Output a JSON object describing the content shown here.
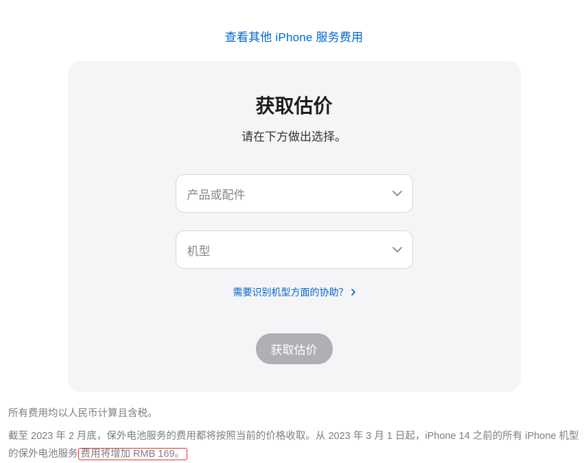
{
  "topLink": "查看其他 iPhone 服务费用",
  "card": {
    "title": "获取估价",
    "subtitle": "请在下方做出选择。",
    "select1Placeholder": "产品或配件",
    "select2Placeholder": "机型",
    "helpLink": "需要识别机型方面的协助？",
    "cta": "获取估价"
  },
  "footnote1": "所有费用均以人民币计算且含税。",
  "notice": {
    "prefix": "截至 2023 年 2 月底，保外电池服务的费用都将按照当前的价格收取。从 2023 年 3 月 1 日起，iPhone 14 之前的所有 iPhone 机型的保外电池服务",
    "highlighted": "费用将增加 RMB 169。"
  }
}
